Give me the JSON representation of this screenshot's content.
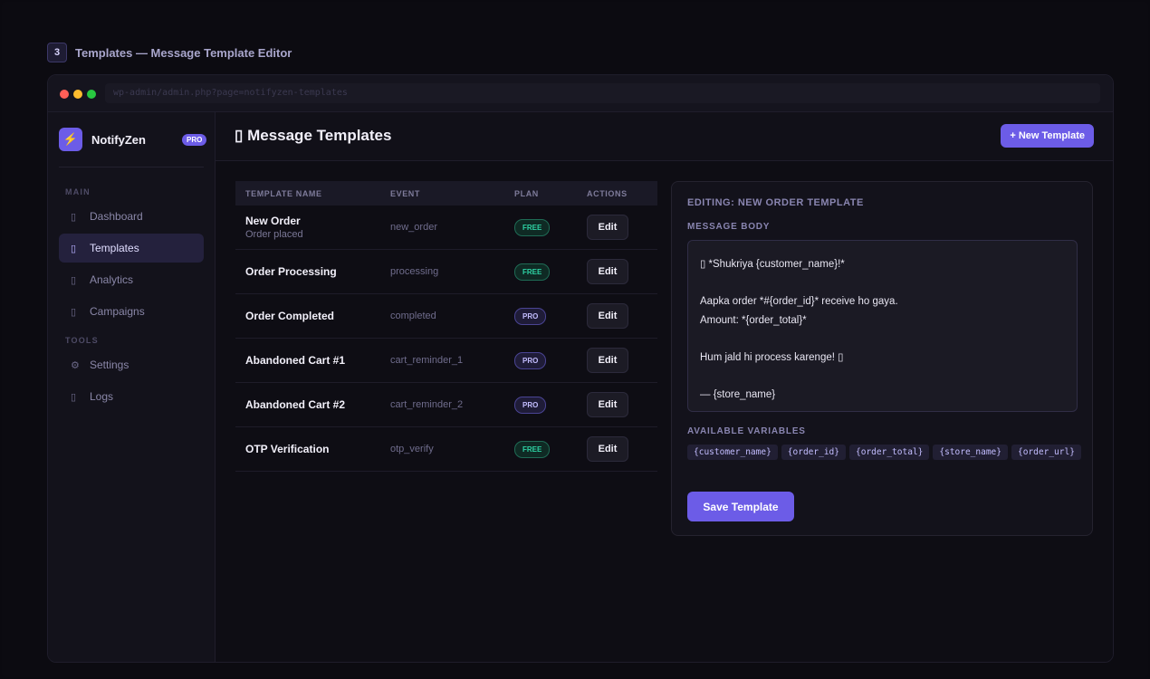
{
  "step": {
    "number": "3",
    "title": "Templates — Message Template Editor"
  },
  "browser": {
    "url": "wp-admin/admin.php?page=notifyzen-templates"
  },
  "brand": {
    "logo_glyph": "⚡",
    "name": "NotifyZen",
    "badge": "PRO"
  },
  "sidebar": {
    "sections": [
      "MAIN",
      "TOOLS"
    ],
    "items": [
      {
        "icon": "grid-icon",
        "glyph": "▯",
        "label": "Dashboard",
        "active": false
      },
      {
        "icon": "template-icon",
        "glyph": "▯",
        "label": "Templates",
        "active": true
      },
      {
        "icon": "analytics-icon",
        "glyph": "▯",
        "label": "Analytics",
        "active": false
      },
      {
        "icon": "campaign-icon",
        "glyph": "▯",
        "label": "Campaigns",
        "active": false
      },
      {
        "icon": "gear-icon",
        "glyph": "⚙",
        "label": "Settings",
        "active": false
      },
      {
        "icon": "logs-icon",
        "glyph": "▯",
        "label": "Logs",
        "active": false
      }
    ]
  },
  "header": {
    "title": "▯ Message Templates",
    "new_button": "+ New Template"
  },
  "table": {
    "columns": [
      "TEMPLATE NAME",
      "EVENT",
      "PLAN",
      "ACTIONS"
    ],
    "rows": [
      {
        "name": "New Order",
        "sub": "Order placed",
        "event": "new_order",
        "plan": "FREE",
        "action": "Edit"
      },
      {
        "name": "Order Processing",
        "sub": "",
        "event": "processing",
        "plan": "FREE",
        "action": "Edit"
      },
      {
        "name": "Order Completed",
        "sub": "",
        "event": "completed",
        "plan": "PRO",
        "action": "Edit"
      },
      {
        "name": "Abandoned Cart #1",
        "sub": "",
        "event": "cart_reminder_1",
        "plan": "PRO",
        "action": "Edit"
      },
      {
        "name": "Abandoned Cart #2",
        "sub": "",
        "event": "cart_reminder_2",
        "plan": "PRO",
        "action": "Edit"
      },
      {
        "name": "OTP Verification",
        "sub": "",
        "event": "otp_verify",
        "plan": "FREE",
        "action": "Edit"
      }
    ]
  },
  "editor": {
    "title": "EDITING: NEW ORDER TEMPLATE",
    "body_label": "MESSAGE BODY",
    "body_lines": [
      "▯ *Shukriya {customer_name}!*",
      "",
      "Aapka order *#{order_id}* receive ho gaya.",
      "Amount: *{order_total}*",
      "",
      "Hum jald hi process karenge! ▯",
      "",
      "— {store_name}"
    ],
    "vars_label": "AVAILABLE VARIABLES",
    "variables": [
      "{customer_name}",
      "{order_id}",
      "{order_total}",
      "{store_name}",
      "{order_url}"
    ],
    "save_button": "Save Template"
  },
  "colors": {
    "accent": "#6c5ce7",
    "free": "#2ed3a4",
    "pro": "#c3bdff",
    "background": "#0e0d14"
  }
}
